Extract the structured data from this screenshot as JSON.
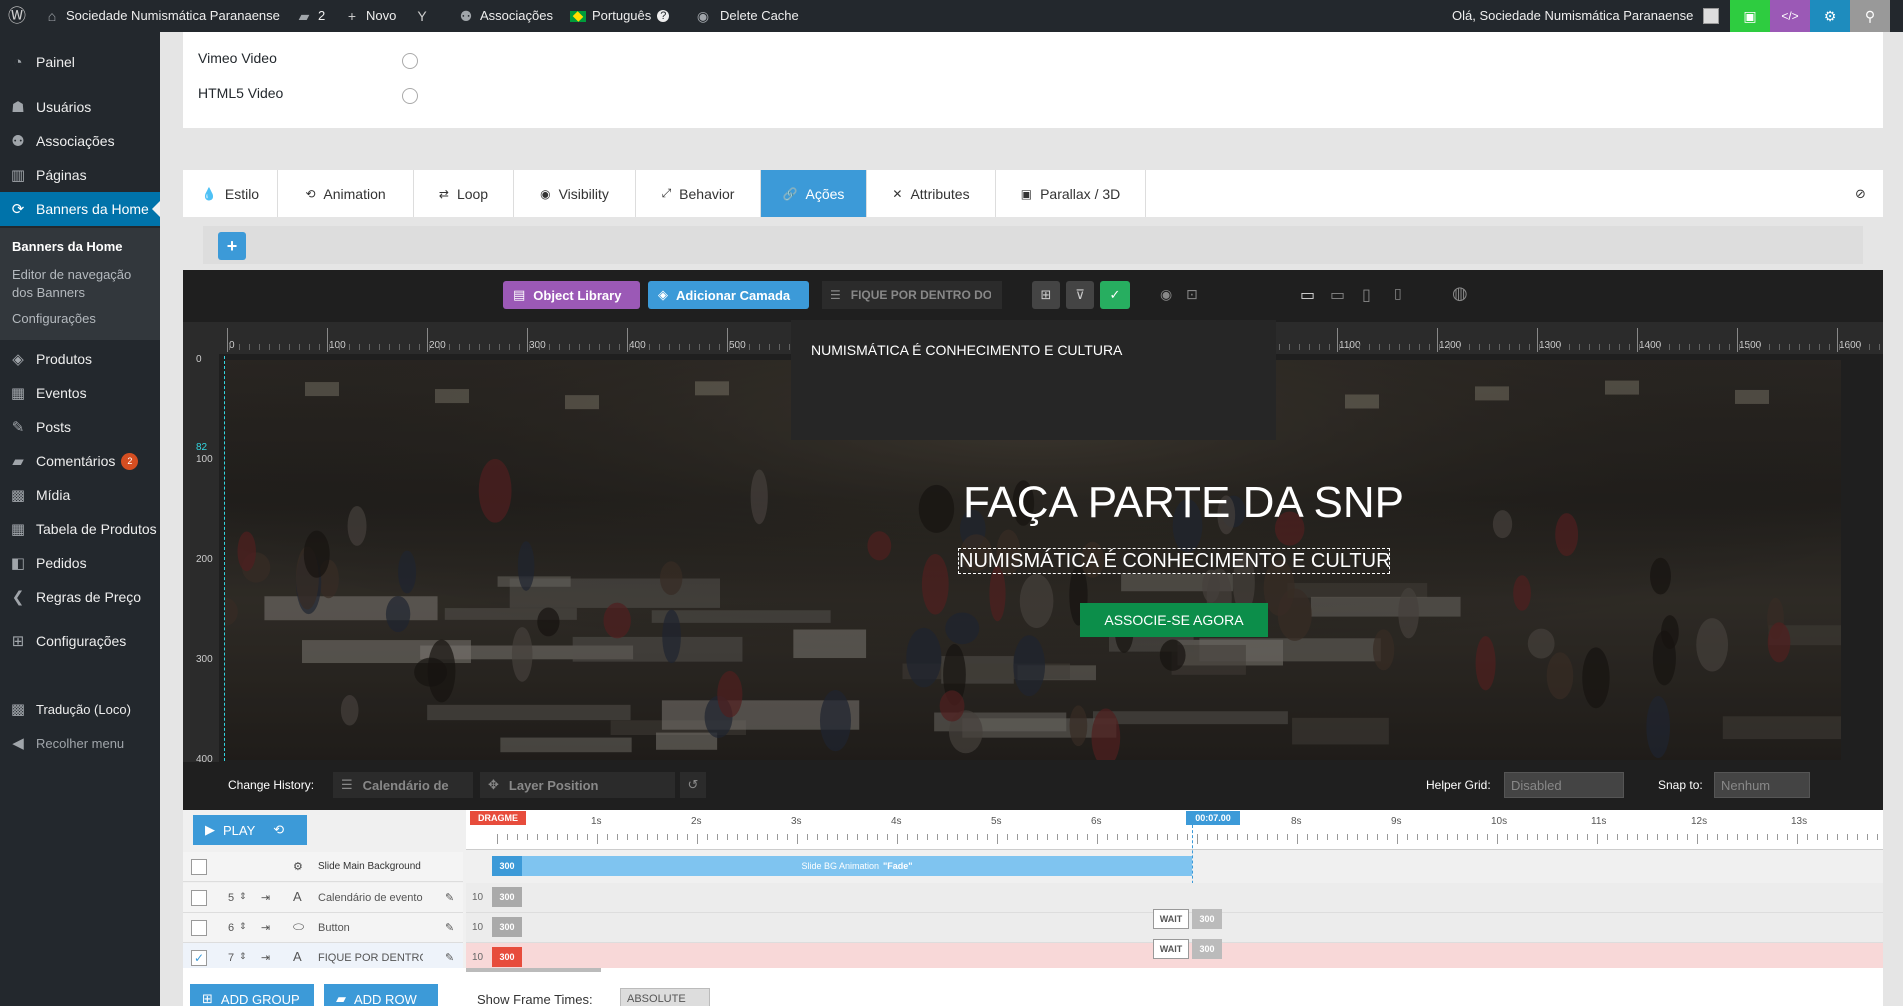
{
  "adminbar": {
    "site_name": "Sociedade Numismática Paranaense",
    "comments_count": "2",
    "new_label": "Novo",
    "associations_label": "Associações",
    "language_label": "Português",
    "delete_cache_label": "Delete Cache",
    "greeting": "Olá, Sociedade Numismática Paranaense",
    "code_label": "</>",
    "colors": {
      "save": "#2ecc40",
      "code": "#9b59b6",
      "settings": "#1e8cbe",
      "search": "#999999"
    }
  },
  "sidebar": {
    "items": [
      {
        "label": "Painel",
        "icon": "dashboard-icon"
      },
      {
        "label": "Usuários",
        "icon": "users-icon"
      },
      {
        "label": "Associações",
        "icon": "groups-icon"
      },
      {
        "label": "Páginas",
        "icon": "pages-icon"
      },
      {
        "label": "Banners da Home",
        "icon": "banner-icon",
        "active": true
      },
      {
        "label": "Produtos",
        "icon": "products-icon"
      },
      {
        "label": "Eventos",
        "icon": "calendar-icon"
      },
      {
        "label": "Posts",
        "icon": "pin-icon"
      },
      {
        "label": "Comentários",
        "icon": "comment-icon",
        "badge": "2"
      },
      {
        "label": "Mídia",
        "icon": "media-icon"
      },
      {
        "label": "Tabela de Produtos",
        "icon": "table-icon"
      },
      {
        "label": "Pedidos",
        "icon": "woo-icon"
      },
      {
        "label": "Regras de Preço",
        "icon": "back-icon"
      },
      {
        "label": "Configurações",
        "icon": "settings-icon"
      },
      {
        "label": "Tradução (Loco)",
        "icon": "translate-icon"
      },
      {
        "label": "Recolher menu",
        "icon": "collapse-icon"
      }
    ],
    "submenu": {
      "title": "Banners da Home",
      "editor": "Editor de navegação dos Banners",
      "settings": "Configurações"
    }
  },
  "video": {
    "options": [
      "Vimeo Video",
      "HTML5 Video"
    ]
  },
  "tabs": [
    {
      "label": "Estilo",
      "icon": "drop-icon"
    },
    {
      "label": "Animation",
      "icon": "history-icon"
    },
    {
      "label": "Loop",
      "icon": "loop-icon"
    },
    {
      "label": "Visibility",
      "icon": "eye-icon"
    },
    {
      "label": "Behavior",
      "icon": "arrows-icon"
    },
    {
      "label": "Ações",
      "icon": "link-icon",
      "active": true
    },
    {
      "label": "Attributes",
      "icon": "tools-icon"
    },
    {
      "label": "Parallax / 3D",
      "icon": "image-icon"
    }
  ],
  "toolbar": {
    "object_library": "Object Library",
    "add_layer": "Adicionar Camada",
    "layer_field": "FIQUE POR DENTRO DO",
    "colors": {
      "object_library": "#9b59b6",
      "add_layer": "#3c9ad8",
      "check": "#27ae60"
    }
  },
  "ruler": {
    "h": [
      "0",
      "100",
      "200",
      "300",
      "400",
      "500",
      "1100",
      "1200",
      "1300",
      "1400",
      "1500",
      "1600"
    ],
    "v": [
      "0",
      "100",
      "200",
      "300",
      "400"
    ],
    "marker": "82"
  },
  "slide": {
    "dropdown_text": "NUMISMÁTICA É CONHECIMENTO E CULTURA",
    "title": "FAÇA PARTE DA SNP",
    "subtitle": "NUMISMÁTICA É CONHECIMENTO E CULTURA",
    "button": "ASSOCIE-SE AGORA",
    "button_color": "#0c8e4a"
  },
  "history": {
    "label": "Change History:",
    "item1": "Calendário de",
    "item2": "Layer Position",
    "helper_grid_label": "Helper Grid:",
    "helper_grid_value": "Disabled",
    "snap_label": "Snap to:",
    "snap_value": "Nenhum"
  },
  "timeline": {
    "play": "PLAY",
    "dragme": "DRAGME",
    "time_marker": "00:07.00",
    "seconds": [
      "1s",
      "2s",
      "3s",
      "4s",
      "5s",
      "6s",
      "8s",
      "9s",
      "10s",
      "11s",
      "12s",
      "13s"
    ],
    "bg_row": "Slide Main Background",
    "bg_block": "300",
    "bg_animation": "Slide BG Animation",
    "bg_effect": "\"Fade\"",
    "rows": [
      {
        "num": "5",
        "label": "Calendário de evento",
        "delay": "10",
        "block": "300"
      },
      {
        "num": "6",
        "label": "Button",
        "delay": "10",
        "block": "300",
        "wait": "WAIT",
        "wait_block": "300"
      },
      {
        "num": "7",
        "label": "FIQUE POR DENTRO",
        "delay": "10",
        "block": "300",
        "wait": "WAIT",
        "wait_block": "300"
      }
    ],
    "add_group": "ADD GROUP",
    "add_row": "ADD ROW",
    "frame_times_label": "Show Frame Times:",
    "frame_times_value": "ABSOLUTE"
  }
}
